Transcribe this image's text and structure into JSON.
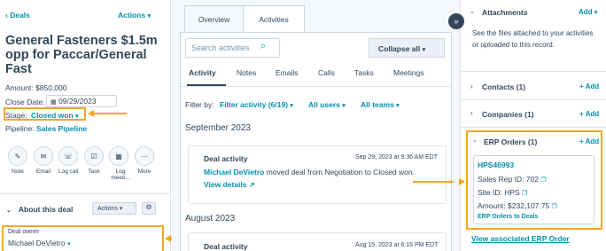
{
  "left": {
    "back_label": "Deals",
    "actions_label": "Actions",
    "title": "General Fasteners $1.5m opp for Paccar/General Fast",
    "amount": "Amount: $850,000",
    "close_date_label": "Close Date:",
    "close_date_value": "09/29/2023",
    "stage_label": "Stage:",
    "stage_value": "Closed won",
    "pipeline_label": "Pipeline:",
    "pipeline_value": "Sales Pipeline",
    "activity_buttons": [
      {
        "label": "Note",
        "icon": "note-icon"
      },
      {
        "label": "Email",
        "icon": "email-icon"
      },
      {
        "label": "Log call",
        "icon": "phone-icon"
      },
      {
        "label": "Task",
        "icon": "task-icon"
      },
      {
        "label": "Log meeti...",
        "icon": "calendar-icon"
      },
      {
        "label": "More",
        "icon": "more-icon"
      }
    ],
    "about_label": "About this deal",
    "about_actions_label": "Actions",
    "deal_owner_label": "Deal owner",
    "deal_owner_value": "Michael DeVietro"
  },
  "mid": {
    "tabs": [
      "Overview",
      "Activities"
    ],
    "search_placeholder": "Search activities",
    "collapse_all_label": "Collapse all",
    "sub_tabs": [
      "Activity",
      "Notes",
      "Emails",
      "Calls",
      "Tasks",
      "Meetings"
    ],
    "filter_by_label": "Filter by:",
    "filter_activity_label": "Filter activity (6/19)",
    "all_users_label": "All users",
    "all_teams_label": "All teams",
    "month1": "September 2023",
    "card1": {
      "title": "Deal activity",
      "timestamp": "Sep 29, 2023 at 9:36 AM EDT",
      "actor": "Michael DeVietro",
      "body": " moved deal from Negotiation to Closed won.",
      "details_label": "View details"
    },
    "month2": "August 2023",
    "card2": {
      "title": "Deal activity",
      "timestamp": "Aug 15, 2023 at 6:16 PM EDT"
    }
  },
  "right": {
    "attachments_label": "Attachments",
    "attachments_add": "Add",
    "attachments_desc": "See the files attached to your activities or uploaded to this record.",
    "contacts_label": "Contacts (1)",
    "contacts_add": "+ Add",
    "companies_label": "Companies (1)",
    "companies_add": "+ Add",
    "erp_label": "ERP Orders (1)",
    "erp_add": "+ Add",
    "erp_order_id": "HPS46993",
    "sales_rep_line": "Sales Rep ID:  702",
    "site_line": "Site ID:  HPS",
    "amount_line": "Amount:  $232,107.75",
    "erp_link": "ERP Orders to Deals",
    "view_assoc_label": "View associated ERP Order"
  },
  "colors": {
    "accent": "#0091ae",
    "highlight": "#f5a623",
    "text": "#33475b",
    "border": "#cbd6e2"
  }
}
